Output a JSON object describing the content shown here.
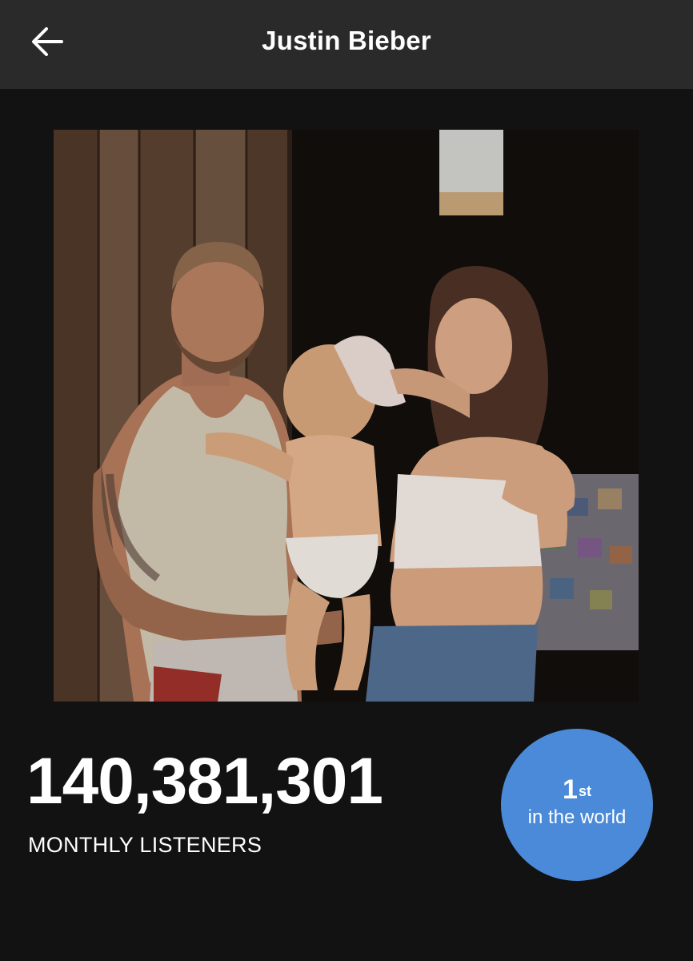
{
  "header": {
    "back_icon": "arrow-left-icon",
    "title": "Justin Bieber"
  },
  "cover": {
    "description": "artist photo"
  },
  "stats": {
    "monthly_listeners": "140,381,301",
    "monthly_listeners_label": "MONTHLY LISTENERS",
    "rank": {
      "number": "1",
      "suffix": "st",
      "caption": "in the world",
      "color": "#4a8ad9"
    }
  }
}
